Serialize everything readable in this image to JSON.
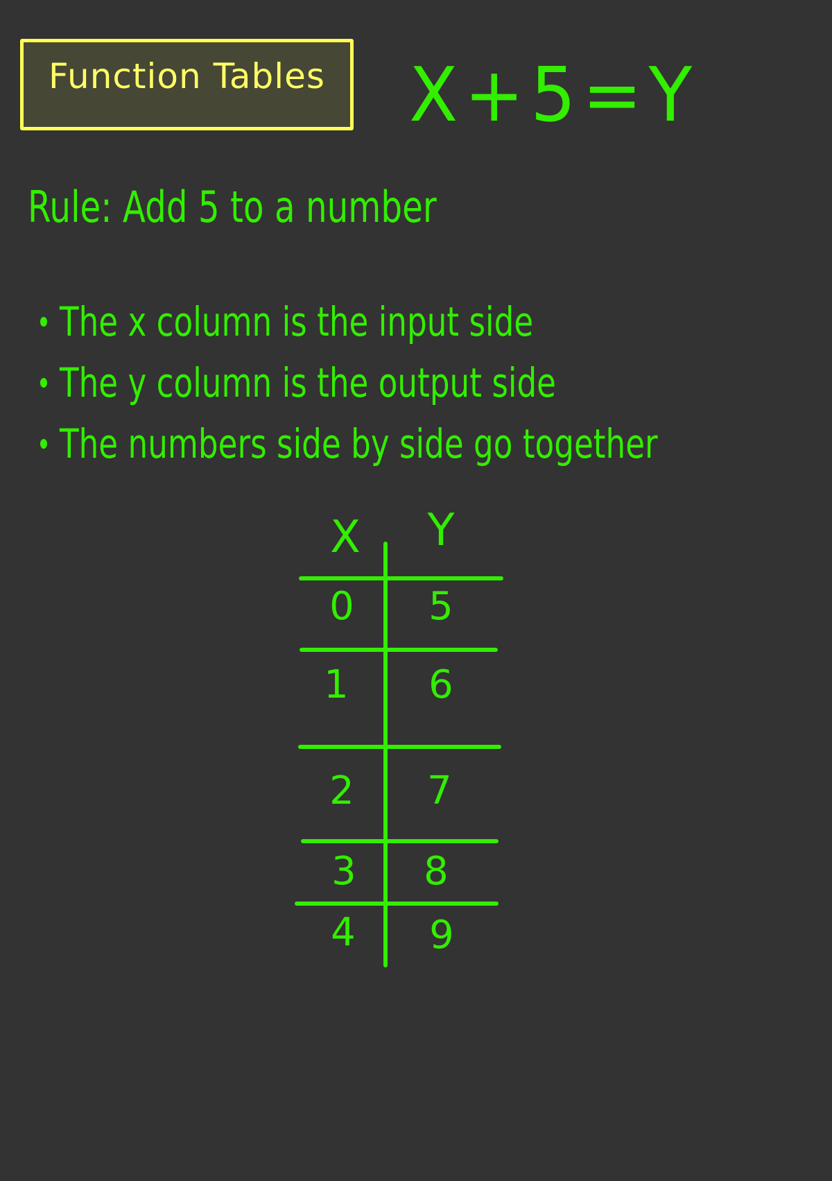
{
  "title": "Function Tables",
  "equation": "X+5=Y",
  "rule": "Rule: Add 5 to a number",
  "bullets": [
    "The x column is the input side",
    "The y column is the output side",
    "The numbers side by side go together"
  ],
  "table": {
    "headers": [
      "X",
      "Y"
    ],
    "rows": [
      {
        "x": "0",
        "y": "5"
      },
      {
        "x": "1",
        "y": "6"
      },
      {
        "x": "2",
        "y": "7"
      },
      {
        "x": "3",
        "y": "8"
      },
      {
        "x": "4",
        "y": "9"
      }
    ]
  },
  "colors": {
    "background": "#333333",
    "ink": "#33ee00",
    "title_border": "#ffff55",
    "title_text": "#ffff66",
    "title_fill": "#474735"
  }
}
